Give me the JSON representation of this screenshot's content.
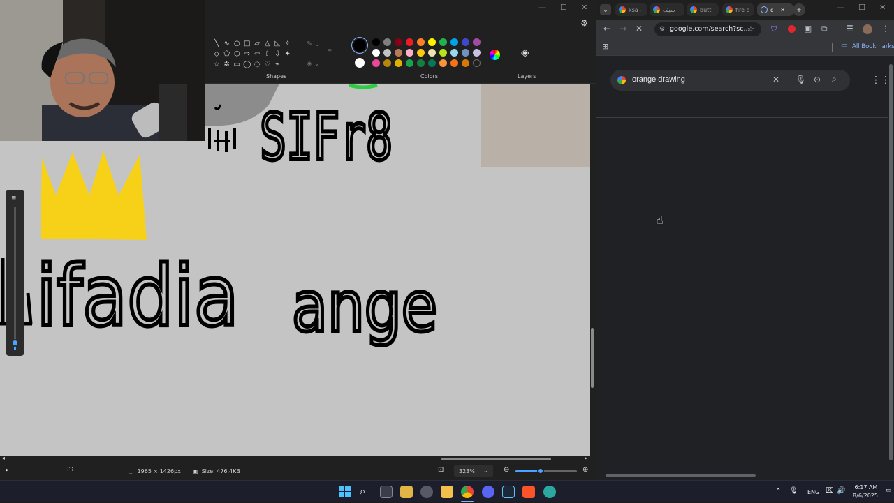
{
  "paint": {
    "ribbon": {
      "shapes_label": "Shapes",
      "colors_label": "Colors",
      "layers_label": "Layers",
      "shape_icons": [
        "╲",
        "∿",
        "○",
        "□",
        "▱",
        "△",
        "◺",
        "✧",
        "◇",
        "⬠",
        "⬡",
        "⇨",
        "⇦",
        "⇧",
        "⇩",
        "✦",
        "☆",
        "✲",
        "▭",
        "◯",
        "◌",
        "♡",
        "⌁"
      ],
      "primary_color": "#000000",
      "secondary_color": "#ffffff",
      "palette": [
        "#000000",
        "#7f7f7f",
        "#880015",
        "#ed1c24",
        "#ff7f27",
        "#fff200",
        "#22b14c",
        "#00a2e8",
        "#3f48cc",
        "#a349a4",
        "#ffffff",
        "#c3c3c3",
        "#b97a57",
        "#ffaec9",
        "#ffc90e",
        "#efe4b0",
        "#b5e61d",
        "#99d9ea",
        "#7092be",
        "#c8bfe7",
        "#ec4899",
        "#b8860b",
        "#e0b000",
        "#16a34a",
        "#15803d",
        "#047857",
        "#fb923c",
        "#f97316",
        "#d97706",
        ""
      ]
    },
    "canvas": {
      "texts": [
        "SIFr8",
        "ifadia",
        "ange"
      ],
      "crown_color": "#f7d117"
    },
    "status": {
      "image_size": "1965 × 1426px",
      "file_size": "Size: 476.4KB",
      "zoom": "323%"
    }
  },
  "browser": {
    "tabs": [
      {
        "title": "ksa -"
      },
      {
        "title": "سيف"
      },
      {
        "title": "butt"
      },
      {
        "title": "fire c"
      },
      {
        "title": "c"
      }
    ],
    "url": "google.com/search?sc...",
    "bookmarks_label": "All Bookmarks",
    "search_query": "orange drawing"
  },
  "taskbar": {
    "language": "ENG",
    "time": "6:17 AM",
    "date": "8/6/2025"
  }
}
